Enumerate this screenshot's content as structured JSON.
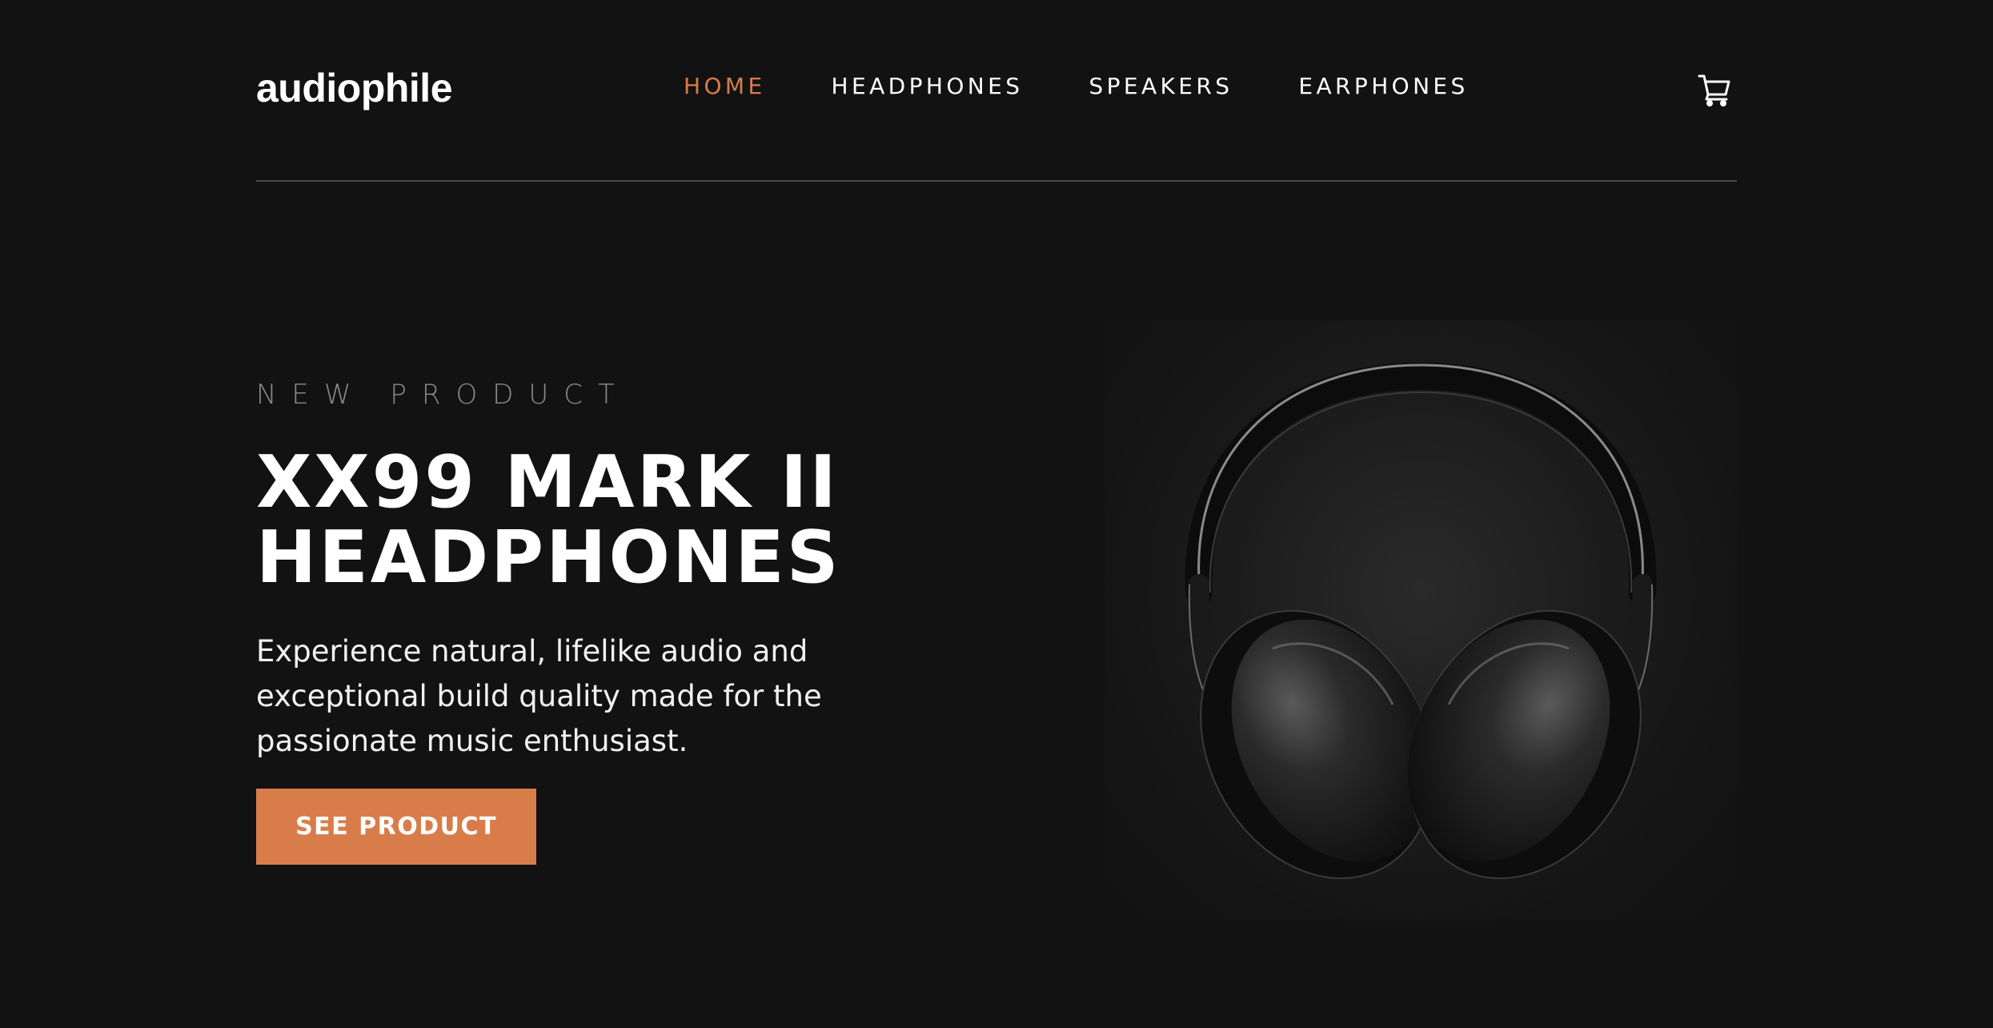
{
  "header": {
    "logo": "audiophile",
    "nav": [
      {
        "label": "HOME",
        "active": true
      },
      {
        "label": "HEADPHONES",
        "active": false
      },
      {
        "label": "SPEAKERS",
        "active": false
      },
      {
        "label": "EARPHONES",
        "active": false
      }
    ],
    "cart_icon": "cart-icon"
  },
  "hero": {
    "overline": "NEW PRODUCT",
    "title_lines": [
      "XX99 MARK II",
      "HEADPHONES"
    ],
    "description_lines": [
      "Experience natural, lifelike audio and",
      "exceptional build quality made for the",
      "passionate music enthusiast."
    ],
    "cta_label": "SEE PRODUCT",
    "image": "headphones-image"
  },
  "colors": {
    "background": "#121212",
    "accent": "#d87d4a",
    "text": "#ffffff",
    "muted": "#8a8a8a",
    "divider": "#4a4a4a"
  }
}
